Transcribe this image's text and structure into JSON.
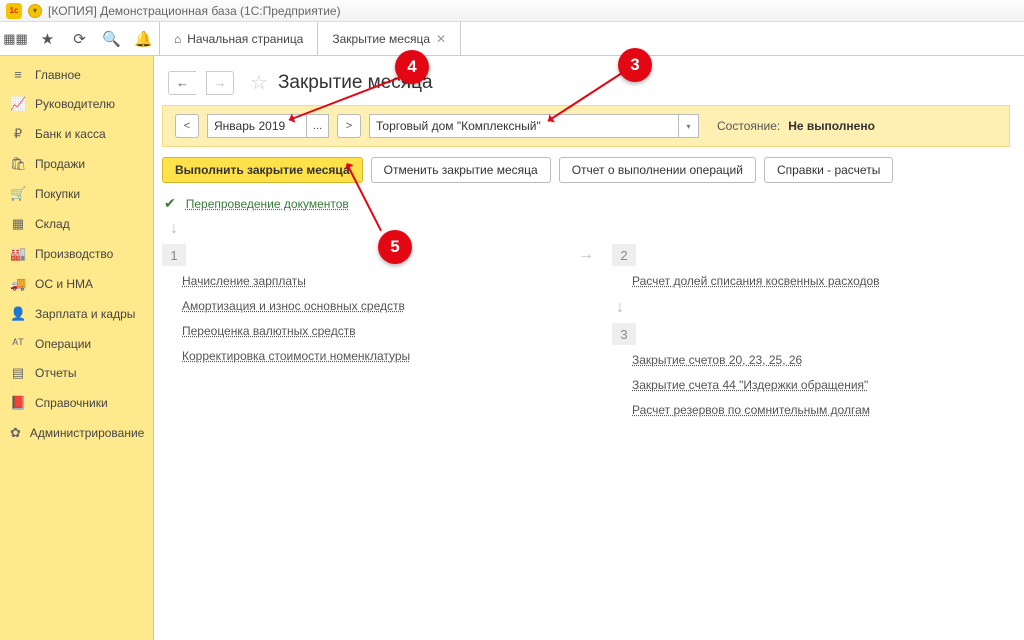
{
  "window_title": "[КОПИЯ] Демонстрационная база  (1С:Предприятие)",
  "tabs": {
    "home": "Начальная страница",
    "current": "Закрытие месяца"
  },
  "sidebar": {
    "items": [
      {
        "icon": "≡",
        "label": "Главное"
      },
      {
        "icon": "📈",
        "label": "Руководителю"
      },
      {
        "icon": "₽",
        "label": "Банк и касса"
      },
      {
        "icon": "🛍",
        "label": "Продажи"
      },
      {
        "icon": "🛒",
        "label": "Покупки"
      },
      {
        "icon": "▦",
        "label": "Склад"
      },
      {
        "icon": "🏭",
        "label": "Производство"
      },
      {
        "icon": "🚚",
        "label": "ОС и НМА"
      },
      {
        "icon": "👤",
        "label": "Зарплата и кадры"
      },
      {
        "icon": "ᴬᵀ",
        "label": "Операции"
      },
      {
        "icon": "▤",
        "label": "Отчеты"
      },
      {
        "icon": "📕",
        "label": "Справочники"
      },
      {
        "icon": "✿",
        "label": "Администрирование"
      }
    ]
  },
  "page_title": "Закрытие месяца",
  "filter": {
    "period": "Январь 2019",
    "organization": "Торговый дом \"Комплексный\"",
    "state_label": "Состояние:",
    "state_value": "Не выполнено"
  },
  "actions": {
    "execute": "Выполнить закрытие месяца",
    "cancel": "Отменить закрытие месяца",
    "report": "Отчет о выполнении операций",
    "refs": "Справки - расчеты"
  },
  "reprocessing": "Перепроведение документов",
  "steps": {
    "s1_label": "1",
    "s2_label": "2",
    "s3_label": "3",
    "group1": [
      "Начисление зарплаты",
      "Амортизация и износ основных средств",
      "Переоценка валютных средств",
      "Корректировка стоимости номенклатуры"
    ],
    "group2": [
      "Расчет долей списания косвенных расходов"
    ],
    "group3": [
      "Закрытие счетов 20, 23, 25, 26",
      "Закрытие счета 44 \"Издержки обращения\"",
      "Расчет резервов по сомнительным долгам"
    ]
  },
  "annotations": {
    "a3": "3",
    "a4": "4",
    "a5": "5"
  }
}
